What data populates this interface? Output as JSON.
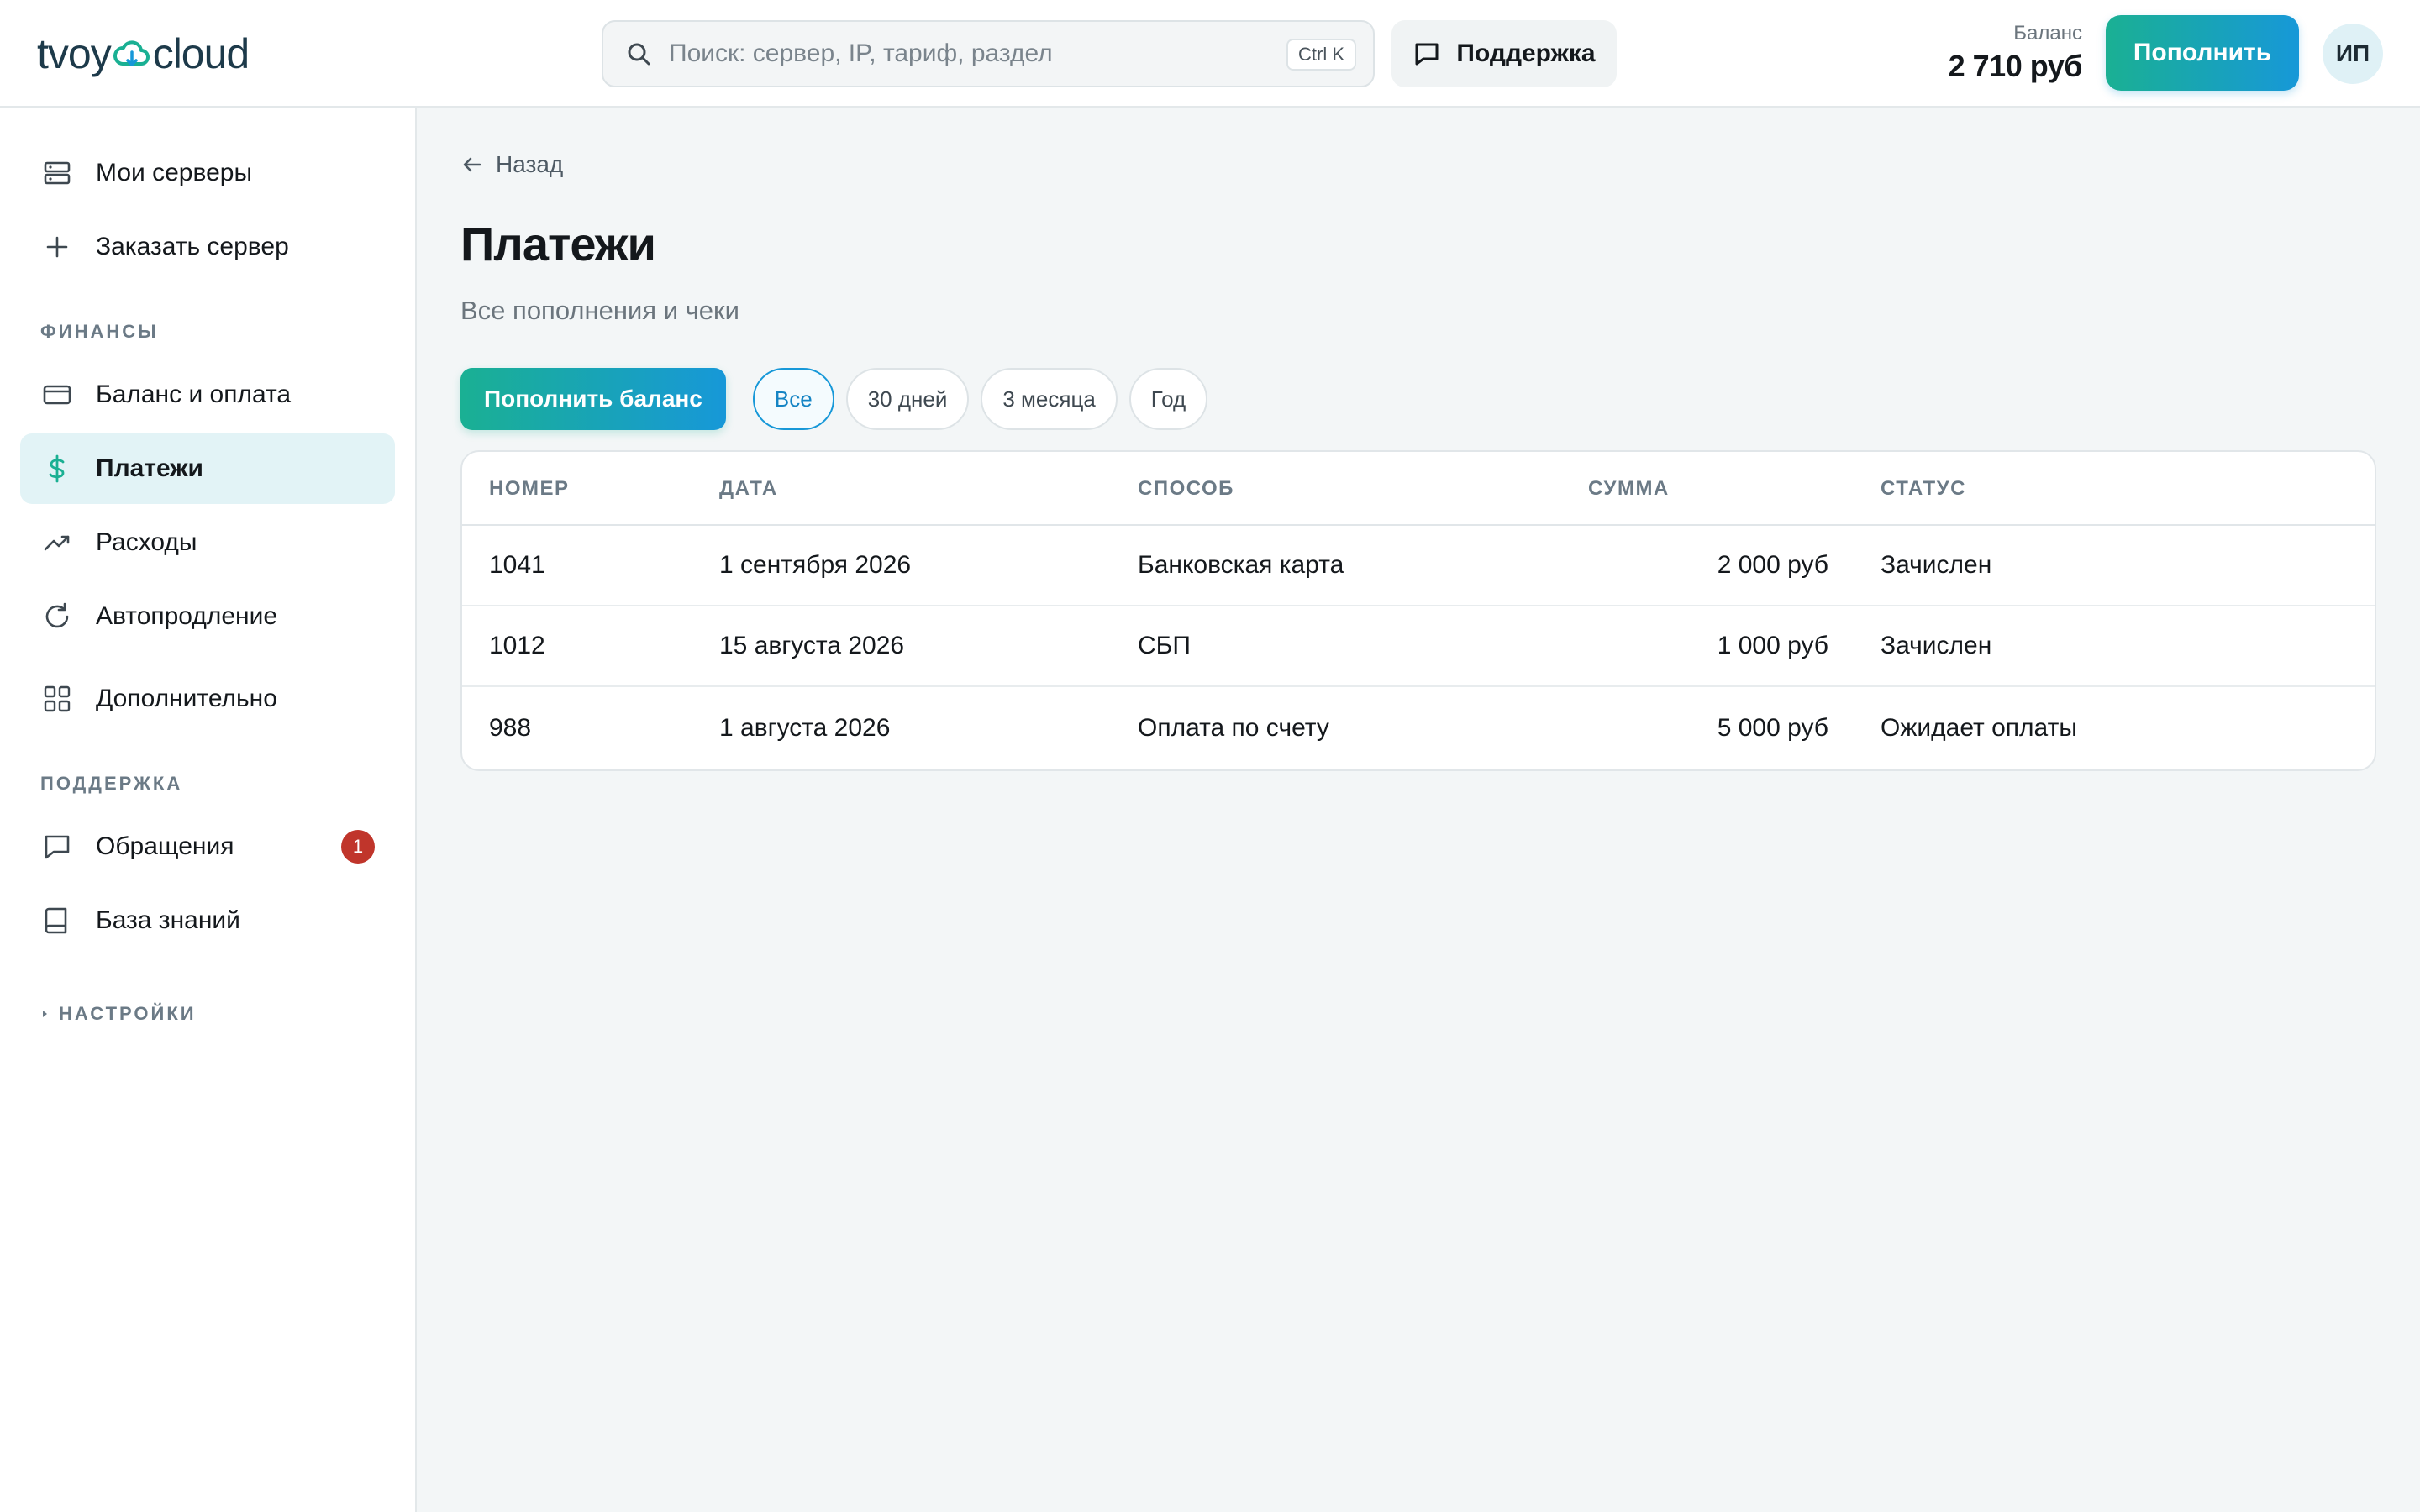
{
  "header": {
    "logo_left": "tvoy",
    "logo_right": "cloud",
    "search_placeholder": "Поиск: сервер, IP, тариф, раздел",
    "search_shortcut": "Ctrl K",
    "support_label": "Поддержка",
    "balance_label": "Баланс",
    "balance_value": "2 710 руб",
    "topup_label": "Пополнить",
    "avatar_initials": "ИП"
  },
  "sidebar": {
    "items_top": [
      {
        "label": "Мои серверы",
        "icon": "server-icon"
      },
      {
        "label": "Заказать сервер",
        "icon": "plus-icon"
      }
    ],
    "section_finance": "ФИНАНСЫ",
    "items_finance": [
      {
        "label": "Баланс и оплата",
        "icon": "credit-card-icon"
      },
      {
        "label": "Платежи",
        "icon": "dollar-icon",
        "active": true
      },
      {
        "label": "Расходы",
        "icon": "trending-up-icon"
      },
      {
        "label": "Автопродление",
        "icon": "refresh-icon"
      },
      {
        "label": "Дополнительно",
        "icon": "grid-icon"
      }
    ],
    "section_support": "ПОДДЕРЖКА",
    "items_support": [
      {
        "label": "Обращения",
        "icon": "message-icon",
        "badge": "1"
      },
      {
        "label": "База знаний",
        "icon": "book-icon"
      }
    ],
    "section_settings": "НАСТРОЙКИ"
  },
  "main": {
    "back_label": "Назад",
    "title": "Платежи",
    "subtitle": "Все пополнения и чеки",
    "topup_balance_label": "Пополнить баланс",
    "filters": [
      "Все",
      "30 дней",
      "3 месяца",
      "Год"
    ],
    "active_filter": "Все",
    "table": {
      "headers": [
        "НОМЕР",
        "ДАТА",
        "СПОСОБ",
        "СУММА",
        "СТАТУС"
      ],
      "rows": [
        [
          "1041",
          "1 сентября 2026",
          "Банковская карта",
          "2 000 руб",
          "Зачислен"
        ],
        [
          "1012",
          "15 августа 2026",
          "СБП",
          "1 000 руб",
          "Зачислен"
        ],
        [
          "988",
          "1 августа 2026",
          "Оплата по счету",
          "5 000 руб",
          "Ожидает оплаты"
        ]
      ]
    }
  },
  "colors": {
    "accent_teal": "#1ab093",
    "accent_blue": "#1798d8",
    "active_nav_bg": "#e2f3f6",
    "badge_red": "#c0352b"
  }
}
